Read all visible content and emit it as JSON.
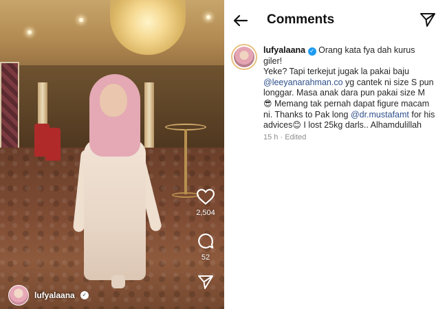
{
  "video": {
    "username": "lufyalaana",
    "likes": "2,504",
    "comments": "52"
  },
  "comments_panel": {
    "title": "Comments",
    "comment": {
      "username": "lufyalaana",
      "line1": "Orang kata fya dah kurus giler!",
      "part1": "Yeke? Tapi terkejut jugak la pakai baju ",
      "mention1": "@leeyanarahman.co",
      "part2": " yg cantek ni size S pun longgar. Masa anak dara pun pakai size M ",
      "emoji1": "😎",
      "part3": " Memang tak pernah dapat figure macam ni. Thanks to Pak long ",
      "mention2": "@dr.mustafamt",
      "part4": " for his advices",
      "emoji2": "😊",
      "part5": " I lost 25kg darls.. Alhamdulillah",
      "time": "15 h",
      "edited": "Edited"
    }
  },
  "icons": {
    "back": "arrow-left-icon",
    "send": "paper-plane-icon",
    "like": "heart-icon",
    "comment": "speech-bubble-icon",
    "share": "paper-plane-icon",
    "verified": "verified-badge-icon"
  },
  "colors": {
    "mention": "#2d4f8a",
    "verified": "#1d9bf0",
    "meta": "#8e8e8e"
  }
}
